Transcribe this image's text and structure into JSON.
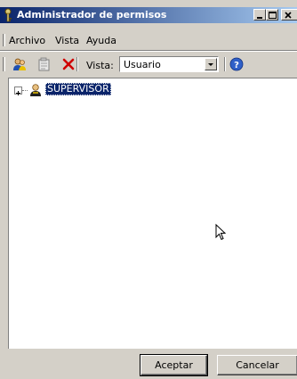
{
  "window": {
    "title": "Administrador de permisos"
  },
  "menu": {
    "items": [
      {
        "label": "Archivo"
      },
      {
        "label": "Vista"
      },
      {
        "label": "Ayuda"
      }
    ]
  },
  "toolbar": {
    "icons": [
      "users-icon",
      "properties-icon",
      "delete-icon",
      "help-icon"
    ],
    "vista_label": "Vista:",
    "vista_value": "Usuario"
  },
  "tree": {
    "nodes": [
      {
        "label": "SUPERVISOR",
        "icon": "user-icon",
        "expanded": false,
        "selected": true
      }
    ]
  },
  "buttons": {
    "ok_label": "Aceptar",
    "cancel_label": "Cancelar"
  },
  "colors": {
    "titlebar_start": "#0a246a",
    "titlebar_end": "#a6caf0",
    "selection": "#0a246a",
    "face": "#d4d0c8"
  }
}
